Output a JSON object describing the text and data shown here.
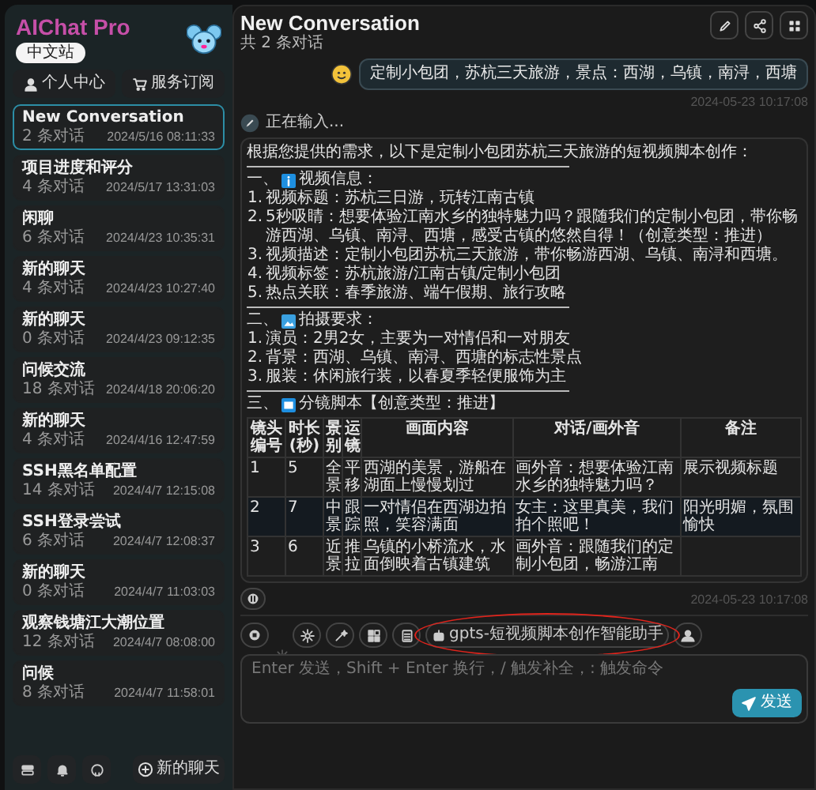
{
  "sidebar": {
    "title": "AIChat Pro",
    "badge": "中文站",
    "buttons": [
      {
        "label": "个人中心",
        "kind": "profile"
      },
      {
        "label": "服务订阅",
        "kind": "cart"
      }
    ],
    "conversations": [
      {
        "title": "New Conversation",
        "count": "2 条对话",
        "time": "2024/5/16 08:11:33",
        "selected": true
      },
      {
        "title": "项目进度和评分",
        "count": "4 条对话",
        "time": "2024/5/17 13:31:03",
        "selected": false
      },
      {
        "title": "闲聊",
        "count": "6 条对话",
        "time": "2024/4/23 10:35:31",
        "selected": false
      },
      {
        "title": "新的聊天",
        "count": "4 条对话",
        "time": "2024/4/23 10:27:40",
        "selected": false
      },
      {
        "title": "新的聊天",
        "count": "0 条对话",
        "time": "2024/4/23 09:12:35",
        "selected": false
      },
      {
        "title": "问候交流",
        "count": "18 条对话",
        "time": "2024/4/18 20:06:20",
        "selected": false
      },
      {
        "title": "新的聊天",
        "count": "4 条对话",
        "time": "2024/4/16 12:47:59",
        "selected": false
      },
      {
        "title": "SSH黑名单配置",
        "count": "14 条对话",
        "time": "2024/4/7 12:15:08",
        "selected": false
      },
      {
        "title": "SSH登录尝试",
        "count": "6 条对话",
        "time": "2024/4/7 12:08:37",
        "selected": false
      },
      {
        "title": "新的聊天",
        "count": "0 条对话",
        "time": "2024/4/7 11:03:03",
        "selected": false
      },
      {
        "title": "观察钱塘江大潮位置",
        "count": "12 条对话",
        "time": "2024/4/7 08:08:00",
        "selected": false
      },
      {
        "title": "问候",
        "count": "8 条对话",
        "time": "2024/4/7 11:58:01",
        "selected": false
      }
    ],
    "new_chat": "新的聊天"
  },
  "chat": {
    "title": "New Conversation",
    "subtitle": "共 2 条对话",
    "user_message": {
      "text": "定制小包团，苏杭三天旅游，景点：西湖，乌镇，南浔，西塘",
      "time": "2024-05-23 10:17:08"
    },
    "bot_message": {
      "status": "正在输入...",
      "intro": "根据您提供的需求，以下是定制小包团苏杭三天旅游的短视频脚本创作：",
      "sections": [
        {
          "kind": "list",
          "number": "一、",
          "title": "视频信息：",
          "items": [
            {
              "number": "1.",
              "text": "视频标题：苏杭三日游，玩转江南古镇"
            },
            {
              "number": "2.",
              "text": "5秒吸睛：想要体验江南水乡的独特魅力吗？跟随我们的定制小包团，带你畅游西湖、乌镇、南浔、西塘，感受古镇的悠然自得！（创意类型：推进）"
            },
            {
              "number": "3.",
              "text": "视频描述：定制小包团苏杭三天旅游，带你畅游西湖、乌镇、南浔和西塘。"
            },
            {
              "number": "4.",
              "text": "视频标签：苏杭旅游/江南古镇/定制小包团"
            },
            {
              "number": "5.",
              "text": "热点关联：春季旅游、端午假期、旅行攻略"
            }
          ]
        },
        {
          "kind": "list",
          "number": "二、",
          "title": "拍摄要求：",
          "items": [
            {
              "number": "1.",
              "text": "演员：2男2女，主要为一对情侣和一对朋友"
            },
            {
              "number": "2.",
              "text": "背景：西湖、乌镇、南浔、西塘的标志性景点"
            },
            {
              "number": "3.",
              "text": "服装：休闲旅行装，以春夏季轻便服饰为主"
            }
          ]
        },
        {
          "kind": "table",
          "number": "三、",
          "title": "分镜脚本【创意类型：推进】",
          "columns": [
            "镜头编号",
            "时长(秒)",
            "景别",
            "运镜",
            "画面内容",
            "对话/画外音",
            "备注"
          ],
          "rows": [
            [
              "1",
              "5",
              "全景",
              "平移",
              "西湖的美景，游船在湖面上慢慢划过",
              "画外音：想要体验江南水乡的独特魅力吗？",
              "展示视频标题"
            ],
            [
              "2",
              "7",
              "中景",
              "跟踪",
              "一对情侣在西湖边拍照，笑容满面",
              "女主：这里真美，我们拍个照吧！",
              "阳光明媚，氛围愉快"
            ],
            [
              "3",
              "6",
              "近景",
              "推拉",
              "乌镇的小桥流水，水面倒映着古镇建筑",
              "画外音：跟随我们的定制小包团，畅游江南"
            ]
          ]
        }
      ],
      "time": "2024-05-23 10:17:08"
    }
  },
  "composer": {
    "assistant": {
      "label": "gpts-短视频脚本创作智能助手",
      "circled": true
    },
    "placeholder": "Enter 发送，Shift + Enter 换行，/ 触发补全，: 触发命令",
    "send": "发送"
  }
}
